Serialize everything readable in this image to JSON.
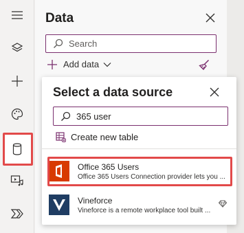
{
  "rail": {
    "items": [
      {
        "name": "menu",
        "icon": "hamburger-icon"
      },
      {
        "name": "tree-view",
        "icon": "layers-icon"
      },
      {
        "name": "insert",
        "icon": "plus-icon"
      },
      {
        "name": "theme",
        "icon": "palette-icon"
      },
      {
        "name": "data",
        "icon": "database-icon",
        "selected": true
      },
      {
        "name": "media",
        "icon": "media-icon"
      },
      {
        "name": "power-automate",
        "icon": "power-automate-icon"
      }
    ]
  },
  "panel": {
    "title": "Data",
    "search_placeholder": "Search",
    "add_data_label": "Add data",
    "close_icon": "close-icon",
    "broom_icon": "broom-icon"
  },
  "popup": {
    "title": "Select a data source",
    "search_value": "365 user",
    "create_table_label": "Create new table",
    "items": [
      {
        "name": "Office 365 Users",
        "description": "Office 365 Users Connection provider lets you ...",
        "icon": "office365-icon",
        "highlighted": true
      },
      {
        "name": "Vineforce",
        "description": "Vineforce is a remote workplace tool built ...",
        "icon": "vineforce-icon",
        "premium": true,
        "premium_icon": "diamond-icon"
      }
    ]
  },
  "colors": {
    "accent": "#7a2f6e",
    "highlight": "#e24a4a",
    "office_red": "#d83b01",
    "vineforce_blue": "#1f3d63"
  }
}
